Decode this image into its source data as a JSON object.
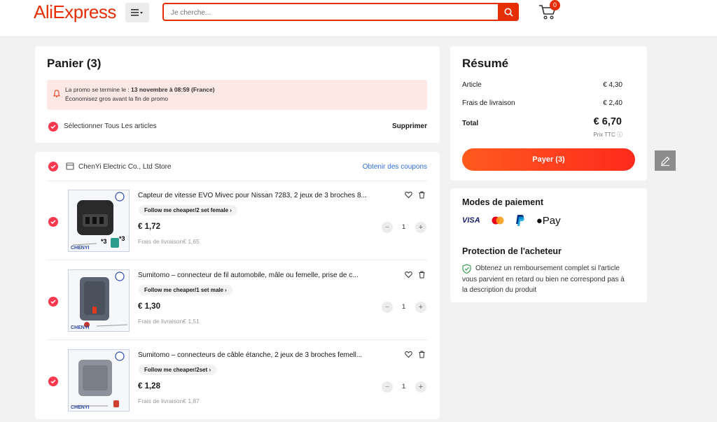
{
  "header": {
    "logo": "AliExpress",
    "search_placeholder": "Je cherche...",
    "cart_count": "0"
  },
  "cart": {
    "title": "Panier (3)",
    "promo_prefix": "La promo se termine le : ",
    "promo_date": "13 novembre à 08:59 (France)",
    "promo_line2": "Économisez gros avant la fin de promo",
    "select_all": "Sélectionner Tous Les articles",
    "delete_label": "Supprimer"
  },
  "store": {
    "name": "ChenYi Electric Co., Ltd Store",
    "coupon_link": "Obtenir des coupons"
  },
  "items": [
    {
      "title": "Capteur de vitesse EVO Mivec pour Nissan 7283, 2 jeux de 3 broches 8...",
      "tag": "Follow me cheaper/2 set female",
      "price": "€ 1,72",
      "shipping": "Frais de livraison€ 1,65",
      "qty": "1",
      "thumb_label": "CHENYI"
    },
    {
      "title": "Sumitomo – connecteur de fil automobile, mâle ou femelle, prise de c...",
      "tag": "Follow me cheaper/1 set male",
      "price": "€ 1,30",
      "shipping": "Frais de livraison€ 1,51",
      "qty": "1",
      "thumb_label": "CHENYI"
    },
    {
      "title": "Sumitomo – connecteurs de câble étanche, 2 jeux de 3 broches femell...",
      "tag": "Follow me cheaper/2set",
      "price": "€ 1,28",
      "shipping": "Frais de livraison€ 1,87",
      "qty": "1",
      "thumb_label": "CHENYI"
    }
  ],
  "summary": {
    "title": "Résumé",
    "article_label": "Article",
    "article_value": "€ 4,30",
    "shipping_label": "Frais de livraison",
    "shipping_value": "€ 2,40",
    "total_label": "Total",
    "total_value": "€ 6,70",
    "ttc_label": "Prix TTC",
    "pay_button": "Payer (3)"
  },
  "payment": {
    "title": "Modes de paiement",
    "visa": "VISA",
    "applepay": "Pay",
    "protection_title": "Protection de l'acheteur",
    "protection_text": "Obtenez un remboursement complet si l'article vous parvient en retard ou bien ne correspond pas à la description du produit"
  },
  "colors": {
    "brand": "#e62e04",
    "check": "#fd384f",
    "link": "#2e6fd8",
    "pay_gradient_start": "#ff5a1f",
    "pay_gradient_end": "#fe2a1c"
  }
}
